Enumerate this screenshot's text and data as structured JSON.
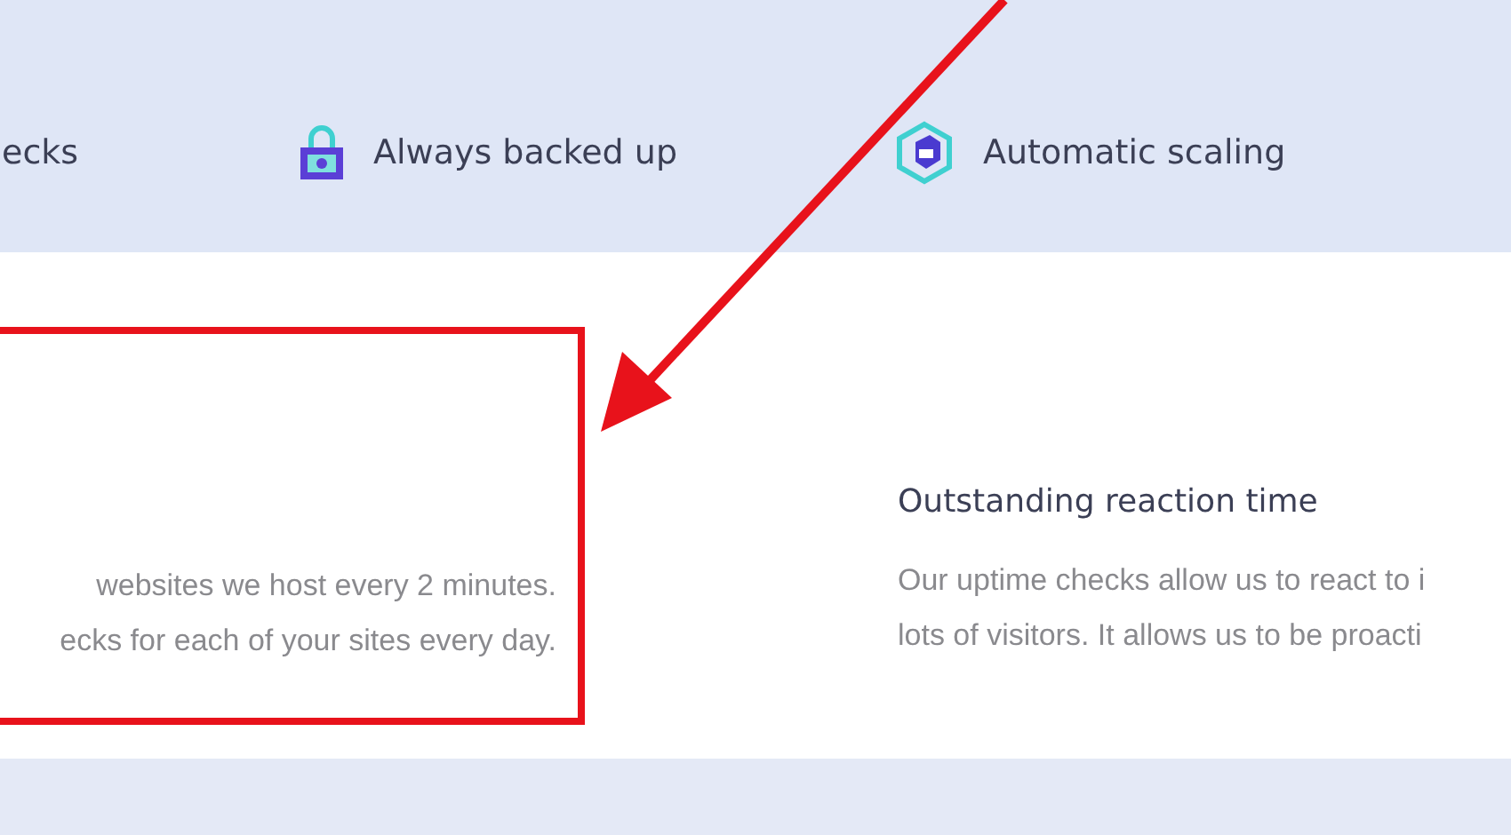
{
  "features": [
    {
      "label": "ecks"
    },
    {
      "label": "Always backed up"
    },
    {
      "label": "Automatic scaling"
    }
  ],
  "columns": [
    {
      "lines": [
        "websites we host every 2 minutes.",
        "ecks for each of your sites every day."
      ]
    },
    {
      "title": "Outstanding reaction time",
      "lines": [
        "Our uptime checks allow us to react to i",
        "lots of visitors. It allows us to be proacti"
      ]
    }
  ]
}
